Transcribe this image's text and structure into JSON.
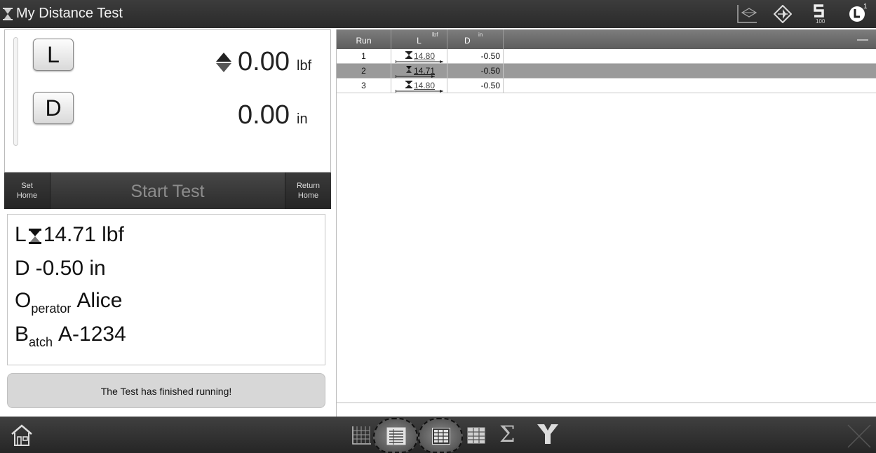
{
  "window": {
    "title": "My Distance Test",
    "badge_100": "100",
    "sup": "1"
  },
  "readout": {
    "l_button": "L",
    "d_button": "D",
    "l_value": "0.00",
    "l_unit": "lbf",
    "d_value": "0.00",
    "d_unit": "in"
  },
  "controls": {
    "set_home_line1": "Set",
    "set_home_line2": "Home",
    "start_test": "Start Test",
    "return_home_line1": "Return",
    "return_home_line2": "Home"
  },
  "results": {
    "l_label": "L",
    "l_value": "14.71 lbf",
    "d_label": "D",
    "d_value": "-0.50 in",
    "operator_big": "O",
    "operator_sub": "perator",
    "operator_value": "Alice",
    "batch_big": "B",
    "batch_sub": "atch",
    "batch_value": "A-1234"
  },
  "status_message": "The Test has finished running!",
  "table": {
    "headers": {
      "run": "Run",
      "l": "L",
      "l_unit": "lbf",
      "d": "D",
      "d_unit": "in"
    },
    "rows": [
      {
        "run": "1",
        "l": "14.80",
        "d": "-0.50",
        "selected": false
      },
      {
        "run": "2",
        "l": "14.71",
        "d": "-0.50",
        "selected": true
      },
      {
        "run": "3",
        "l": "14.80",
        "d": "-0.50",
        "selected": false
      }
    ]
  },
  "bottombar": {
    "sigma": "Σ"
  },
  "colors": {
    "bar_dark": "#2a2a2a",
    "header_gray": "#6e6e6e",
    "selected_row": "#9a9a9a",
    "status_bg": "#d7d7d7"
  }
}
